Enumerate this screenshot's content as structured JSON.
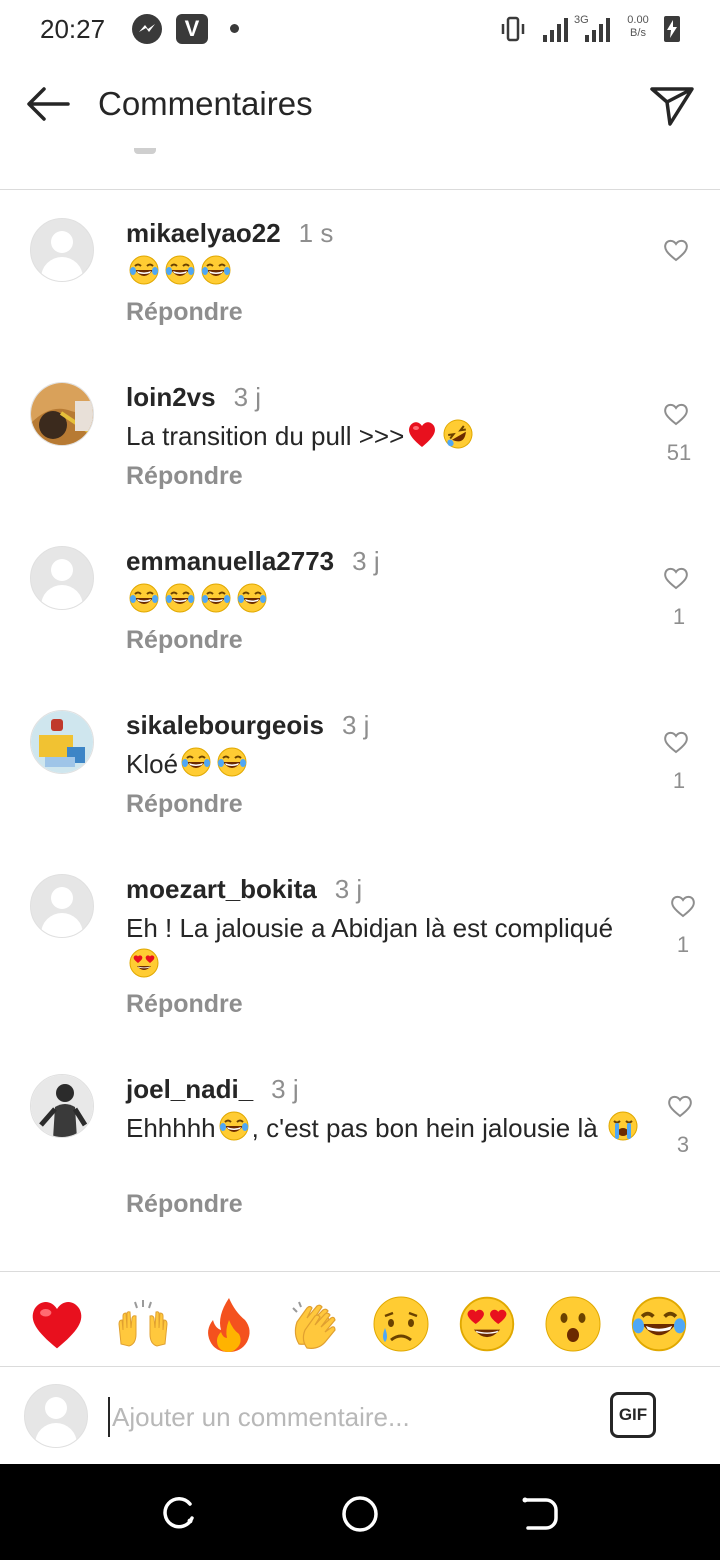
{
  "status_bar": {
    "time": "20:27",
    "network": "3G",
    "speed_value": "0.00",
    "speed_unit": "B/s"
  },
  "header": {
    "title": "Commentaires"
  },
  "comments": [
    {
      "username": "mikaelyao22",
      "time": "1 s",
      "text_before": "",
      "emojis": [
        "joy",
        "joy",
        "joy"
      ],
      "text_after": "",
      "reply_label": "Répondre",
      "likes": "",
      "avatar": "default"
    },
    {
      "username": "loin2vs",
      "time": "3 j",
      "text_before": "La transition du pull >>>",
      "emojis": [
        "red-heart",
        "rofl"
      ],
      "text_after": "",
      "reply_label": "Répondre",
      "likes": "51",
      "avatar": "photo"
    },
    {
      "username": "emmanuella2773",
      "time": "3 j",
      "text_before": "",
      "emojis": [
        "joy",
        "joy",
        "joy",
        "joy"
      ],
      "text_after": "",
      "reply_label": "Répondre",
      "likes": "1",
      "avatar": "default"
    },
    {
      "username": "sikalebourgeois",
      "time": "3 j",
      "text_before": "Kloé",
      "emojis": [
        "joy",
        "joy"
      ],
      "text_after": "",
      "reply_label": "Répondre",
      "likes": "1",
      "avatar": "photo"
    },
    {
      "username": "moezart_bokita",
      "time": "3 j",
      "text_before": "Eh ! La jalousie a Abidjan là est compliqué ",
      "emojis": [
        "heart-eyes"
      ],
      "text_after": "",
      "reply_label": "Répondre",
      "likes": "1",
      "avatar": "default"
    },
    {
      "username": "joel_nadi_",
      "time": "3 j",
      "text_before": "Ehhhhh",
      "emojis": [
        "joy"
      ],
      "text_after": ", c'est pas bon hein jalousie là ",
      "emojis_after": [
        "sob"
      ],
      "reply_label": "Répondre",
      "likes": "3",
      "avatar": "photo"
    }
  ],
  "reactions": [
    "red-heart",
    "raising-hands",
    "fire",
    "clapping-hands",
    "sad-face",
    "heart-eyes",
    "astonished-face",
    "joy"
  ],
  "composer": {
    "placeholder": "Ajouter un commentaire...",
    "gif_label": "GIF"
  }
}
